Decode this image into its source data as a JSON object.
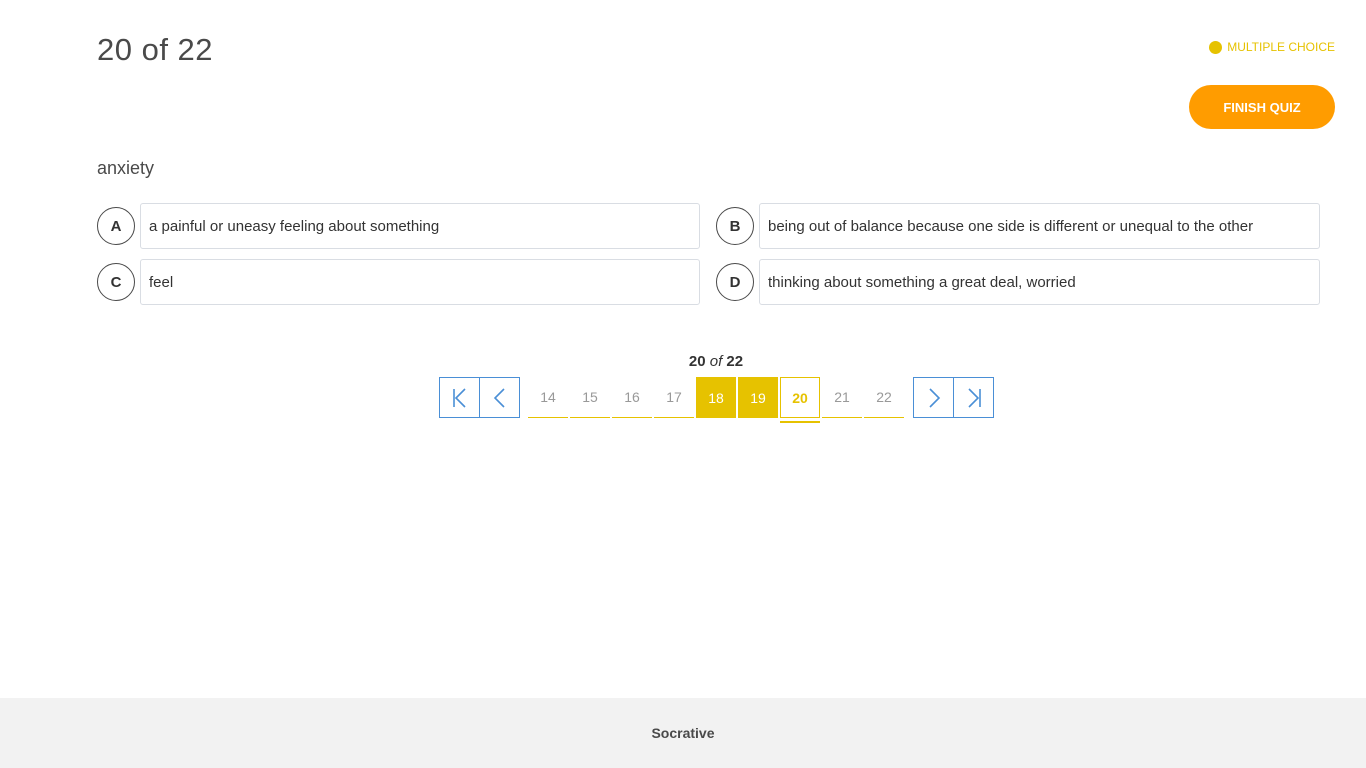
{
  "header": {
    "progress": "20 of 22",
    "question_type": "MULTIPLE CHOICE",
    "finish_label": "FINISH QUIZ"
  },
  "question": {
    "text": "anxiety"
  },
  "answers": [
    {
      "letter": "A",
      "text": "a painful or uneasy feeling about something"
    },
    {
      "letter": "B",
      "text": "being out of balance because one side is different or unequal to the other"
    },
    {
      "letter": "C",
      "text": "feel"
    },
    {
      "letter": "D",
      "text": "thinking about something a great deal, worried"
    }
  ],
  "pager": {
    "current": "20",
    "of": "of",
    "total": "22",
    "pages": [
      {
        "num": "14",
        "state": "unanswered"
      },
      {
        "num": "15",
        "state": "unanswered"
      },
      {
        "num": "16",
        "state": "unanswered"
      },
      {
        "num": "17",
        "state": "unanswered"
      },
      {
        "num": "18",
        "state": "answered"
      },
      {
        "num": "19",
        "state": "answered"
      },
      {
        "num": "20",
        "state": "current"
      },
      {
        "num": "21",
        "state": "unanswered"
      },
      {
        "num": "22",
        "state": "unanswered"
      }
    ]
  },
  "footer": {
    "brand": "Socrative"
  },
  "colors": {
    "accent_yellow": "#e6c200",
    "finish_orange": "#ff9c00",
    "nav_blue": "#4a8fd6"
  }
}
